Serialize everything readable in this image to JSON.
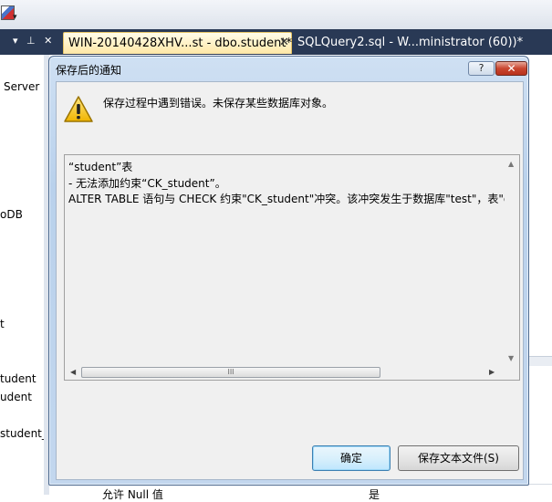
{
  "ide": {
    "active_tab": "WIN-20140428XHV...st - dbo.student*",
    "active_tab_close": "✕",
    "inactive_tab": "SQLQuery2.sql - W...ministrator (60))*",
    "pane_buttons": "▾ ⊥ ✕",
    "tree_items": [
      "Server",
      "oDB",
      "t",
      "tudent",
      "udent",
      "student_"
    ],
    "bottom_property_label": "允许 Null 值",
    "bottom_property_value": "是"
  },
  "dialog": {
    "title": "保存后的通知",
    "help_label": "?",
    "close_label": "✕",
    "message": "保存过程中遇到错误。未保存某些数据库对象。",
    "detail_lines": [
      "“student”表",
      "- 无法添加约束“CK_student”。",
      "ALTER TABLE 语句与 CHECK 约束\"CK_student\"冲突。该冲突发生于数据库\"test\"，表\"d"
    ],
    "scroll_thumb_grip": "III",
    "ok_label": "确定",
    "save_text_label": "保存文本文件(S)"
  },
  "colors": {
    "dock_background": "#293955",
    "active_tab": "#ffe8a6",
    "dialog_frame": "#b9d1ec",
    "close_button": "#c9462f",
    "warning_yellow": "#f5c400"
  },
  "icons": {
    "warning": "warning-triangle-icon",
    "help": "help-icon",
    "close": "close-icon"
  }
}
